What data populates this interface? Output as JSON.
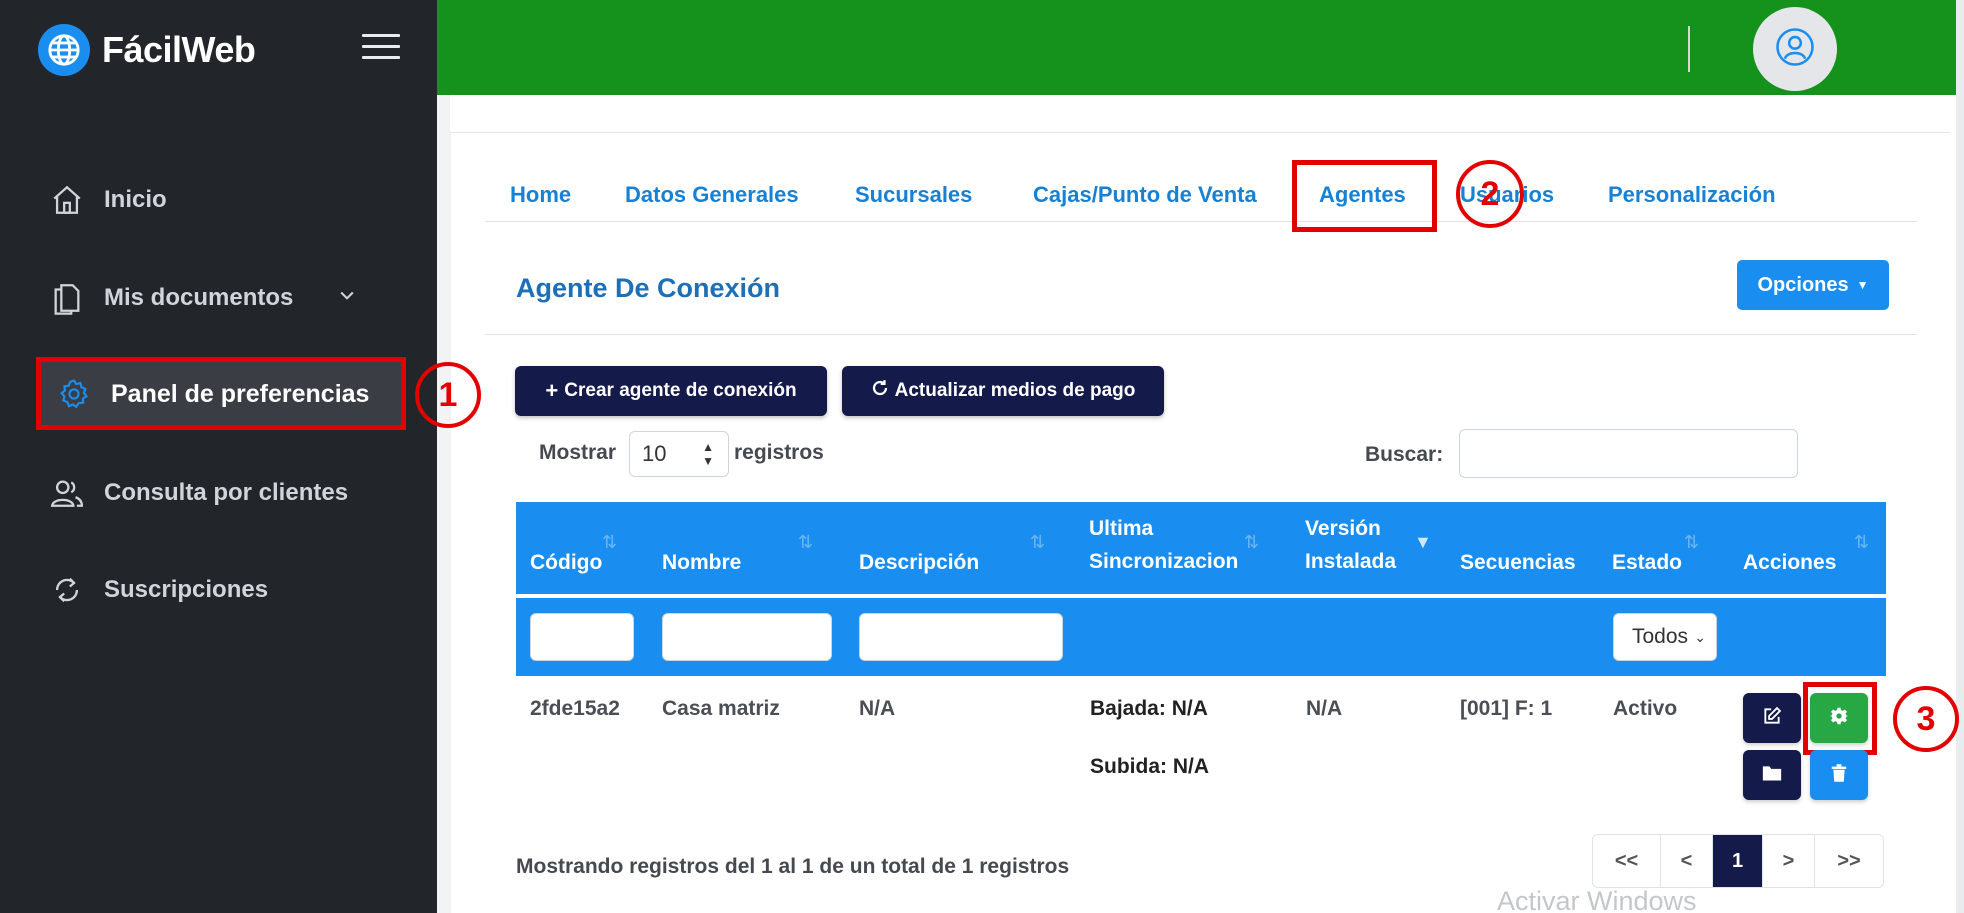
{
  "app": {
    "title": "FácilWeb"
  },
  "sidebar": {
    "items": [
      {
        "label": "Inicio",
        "icon": "home-icon"
      },
      {
        "label": "Mis documentos",
        "icon": "documents-icon"
      },
      {
        "label": "Panel de preferencias",
        "icon": "gear-icon",
        "active": true
      },
      {
        "label": "Consulta por clientes",
        "icon": "users-icon"
      },
      {
        "label": "Suscripciones",
        "icon": "refresh-icon"
      }
    ]
  },
  "tabs": [
    {
      "label": "Home"
    },
    {
      "label": "Datos Generales"
    },
    {
      "label": "Sucursales"
    },
    {
      "label": "Cajas/Punto de Venta"
    },
    {
      "label": "Agentes",
      "active": true
    },
    {
      "label": "Usuarios"
    },
    {
      "label": "Personalización"
    }
  ],
  "section": {
    "title": "Agente De Conexión",
    "options_label": "Opciones",
    "create_label": "Crear agente de conexión",
    "update_label": "Actualizar medios de pago"
  },
  "controls": {
    "show_label": "Mostrar",
    "show_value": "10",
    "records_label": "registros",
    "search_label": "Buscar:"
  },
  "table": {
    "headers": [
      "Código",
      "Nombre",
      "Descripción",
      "Ultima Sincronizacion",
      "Versión Instalada",
      "Secuencias",
      "Estado",
      "Acciones"
    ],
    "estado_filter": "Todos",
    "rows": [
      {
        "codigo": "2fde15a2",
        "nombre": "Casa matriz",
        "descripcion": "N/A",
        "bajada": "Bajada: N/A",
        "subida": "Subida: N/A",
        "version": "N/A",
        "secuencias": "[001] F: 1",
        "estado": "Activo"
      }
    ]
  },
  "footer": {
    "summary": "Mostrando registros del 1 al 1 de un total de 1 registros",
    "pager": [
      "<<",
      "<",
      "1",
      ">",
      ">>"
    ],
    "current_page": "1"
  },
  "watermark": "Activar Windows",
  "annotations": [
    "1",
    "2",
    "3"
  ],
  "colors": {
    "sidebar": "#22252a",
    "topbar": "#15921b",
    "accent": "#1a8ef0",
    "dark_button": "#141a4a",
    "highlight": "#e30000",
    "settings_button": "#28a745"
  }
}
